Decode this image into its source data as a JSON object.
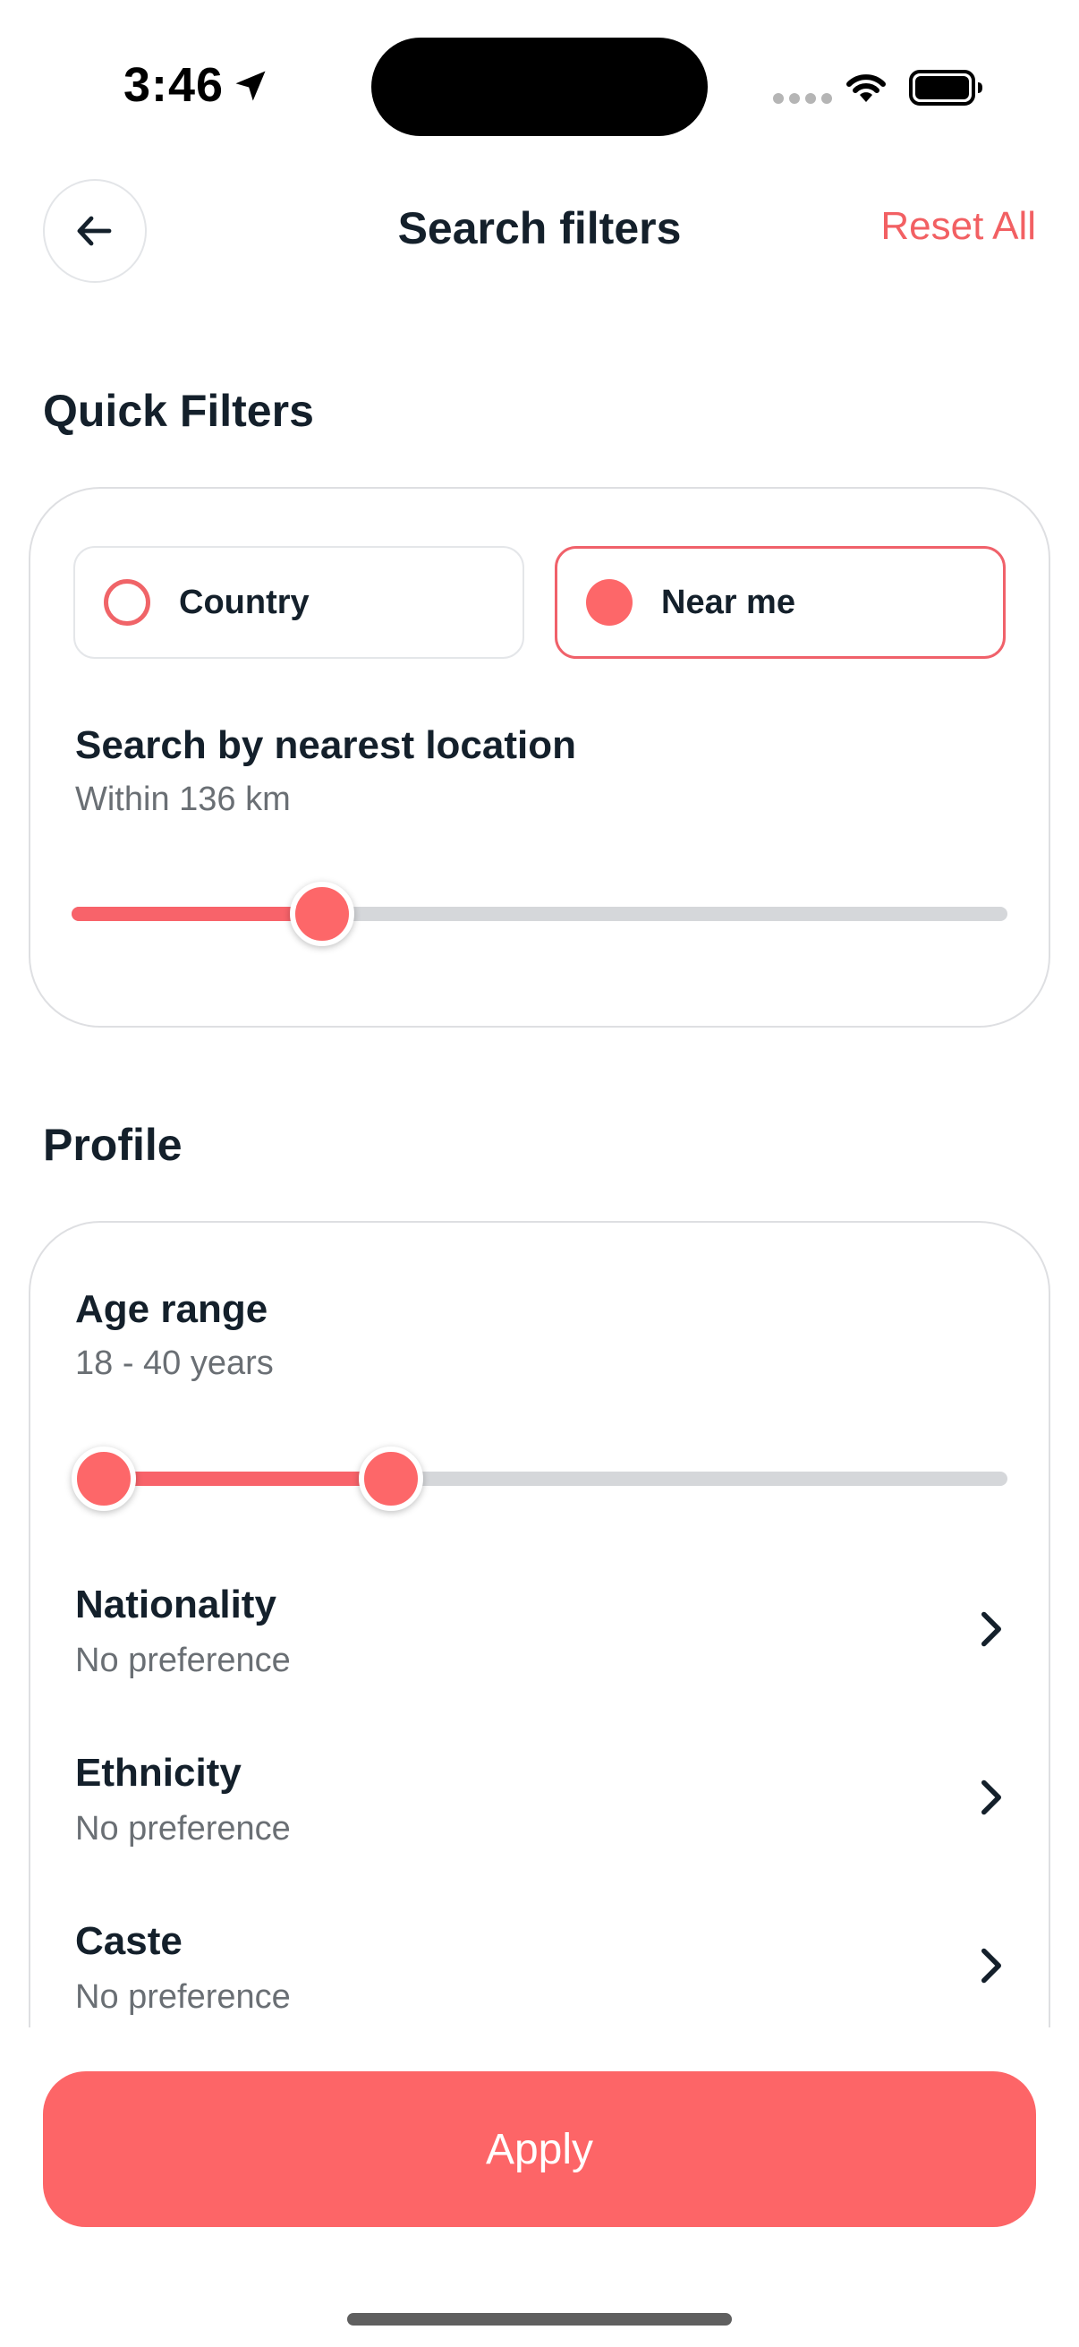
{
  "status_bar": {
    "time": "3:46"
  },
  "header": {
    "title": "Search filters",
    "reset_label": "Reset All"
  },
  "quick_filters": {
    "title": "Quick Filters",
    "options": [
      {
        "label": "Country",
        "selected": false
      },
      {
        "label": "Near me",
        "selected": true
      }
    ],
    "location": {
      "title": "Search by nearest location",
      "subtitle": "Within 136 km",
      "slider_fraction": 0.25
    }
  },
  "profile": {
    "title": "Profile",
    "age": {
      "title": "Age range",
      "subtitle": "18 - 40 years",
      "range_fraction": [
        0.0,
        0.33
      ]
    },
    "rows": [
      {
        "label": "Nationality",
        "value": "No preference"
      },
      {
        "label": "Ethnicity",
        "value": "No preference"
      },
      {
        "label": "Caste",
        "value": "No preference"
      }
    ]
  },
  "footer": {
    "apply_label": "Apply"
  },
  "colors": {
    "accent": "#fd6769",
    "text": "#14202b",
    "muted": "#6a6f74",
    "track": "#d5d7da"
  }
}
